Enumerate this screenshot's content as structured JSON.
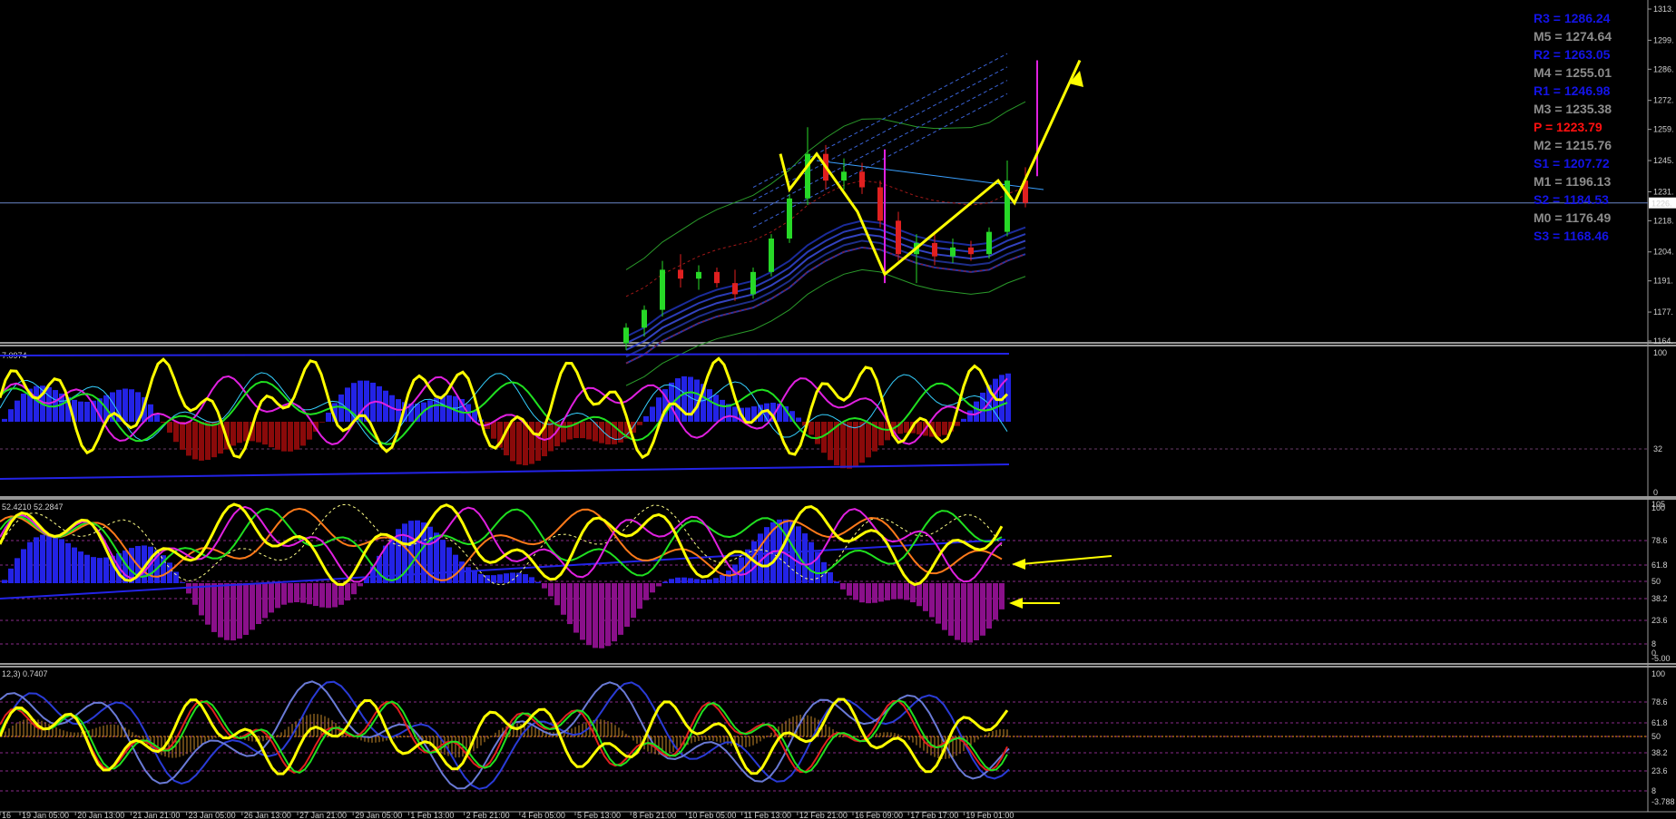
{
  "chart_data": {
    "type": "line",
    "pivot_levels": [
      {
        "label": "R3 = 1286.24",
        "color": "#1414e6"
      },
      {
        "label": "M5 = 1274.64",
        "color": "#8c8c8c"
      },
      {
        "label": "R2 = 1263.05",
        "color": "#1414e6"
      },
      {
        "label": "M4 = 1255.01",
        "color": "#8c8c8c"
      },
      {
        "label": "R1 = 1246.98",
        "color": "#1414e6"
      },
      {
        "label": "M3 = 1235.38",
        "color": "#8c8c8c"
      },
      {
        "label": "P   = 1223.79",
        "color": "#ff1010"
      },
      {
        "label": "M2 = 1215.76",
        "color": "#8c8c8c"
      },
      {
        "label": "S1 = 1207.72",
        "color": "#1414e6"
      },
      {
        "label": "M1 = 1196.13",
        "color": "#8c8c8c"
      },
      {
        "label": "S2 = 1184.53",
        "color": "#1414e6"
      },
      {
        "label": "M0 = 1176.49",
        "color": "#8c8c8c"
      },
      {
        "label": "S3 = 1168.46",
        "color": "#1414e6"
      }
    ],
    "price_axis": {
      "ticks": [
        "1313.",
        "1299.",
        "1286.",
        "1272.",
        "1259.",
        "1245.",
        "1231.",
        "1218.",
        "1204.",
        "1191.",
        "1177.",
        "1164."
      ],
      "current_price": "1226."
    },
    "panes": [
      {
        "header": "7.0974",
        "axis_ticks": [
          "100",
          "32",
          "0"
        ]
      },
      {
        "header": "52.4210 52.2847",
        "axis_ticks": [
          "105",
          "100",
          "78.6",
          "61.8",
          "50",
          "38.2",
          "23.6",
          "8",
          "0",
          "-5.00"
        ]
      },
      {
        "header": "12,3) 0.7407",
        "axis_ticks": [
          "100",
          "78.6",
          "61.8",
          "50",
          "38.2",
          "23.6",
          "8",
          "-3.788"
        ]
      }
    ],
    "time_labels": [
      "16",
      "19 Jan 05:00",
      "20 Jan 13:00",
      "21 Jan 21:00",
      "23 Jan 05:00",
      "26 Jan 13:00",
      "27 Jan 21:00",
      "29 Jan 05:00",
      "1 Feb 13:00",
      "2 Feb 21:00",
      "4 Feb 05:00",
      "5 Feb 13:00",
      "8 Feb 21:00",
      "10 Feb 05:00",
      "11 Feb 13:00",
      "12 Feb 21:00",
      "16 Feb 09:00",
      "17 Feb 17:00",
      "19 Feb 01:00"
    ],
    "candles": [
      {
        "t": 0,
        "o": 1163,
        "h": 1172,
        "l": 1160,
        "c": 1170
      },
      {
        "t": 1,
        "o": 1170,
        "h": 1180,
        "l": 1166,
        "c": 1178
      },
      {
        "t": 2,
        "o": 1178,
        "h": 1200,
        "l": 1175,
        "c": 1196
      },
      {
        "t": 3,
        "o": 1196,
        "h": 1203,
        "l": 1188,
        "c": 1192
      },
      {
        "t": 4,
        "o": 1192,
        "h": 1198,
        "l": 1187,
        "c": 1195
      },
      {
        "t": 5,
        "o": 1195,
        "h": 1197,
        "l": 1188,
        "c": 1190
      },
      {
        "t": 6,
        "o": 1190,
        "h": 1196,
        "l": 1182,
        "c": 1185
      },
      {
        "t": 7,
        "o": 1185,
        "h": 1197,
        "l": 1183,
        "c": 1195
      },
      {
        "t": 8,
        "o": 1195,
        "h": 1212,
        "l": 1193,
        "c": 1210
      },
      {
        "t": 9,
        "o": 1210,
        "h": 1230,
        "l": 1208,
        "c": 1228
      },
      {
        "t": 10,
        "o": 1228,
        "h": 1260,
        "l": 1225,
        "c": 1248
      },
      {
        "t": 11,
        "o": 1248,
        "h": 1252,
        "l": 1232,
        "c": 1236
      },
      {
        "t": 12,
        "o": 1236,
        "h": 1246,
        "l": 1232,
        "c": 1240
      },
      {
        "t": 13,
        "o": 1240,
        "h": 1244,
        "l": 1230,
        "c": 1233
      },
      {
        "t": 14,
        "o": 1233,
        "h": 1236,
        "l": 1215,
        "c": 1218
      },
      {
        "t": 15,
        "o": 1218,
        "h": 1222,
        "l": 1200,
        "c": 1203
      },
      {
        "t": 16,
        "o": 1203,
        "h": 1212,
        "l": 1190,
        "c": 1208
      },
      {
        "t": 17,
        "o": 1208,
        "h": 1213,
        "l": 1198,
        "c": 1202
      },
      {
        "t": 18,
        "o": 1202,
        "h": 1210,
        "l": 1199,
        "c": 1206
      },
      {
        "t": 19,
        "o": 1206,
        "h": 1209,
        "l": 1200,
        "c": 1203
      },
      {
        "t": 20,
        "o": 1203,
        "h": 1215,
        "l": 1201,
        "c": 1213
      },
      {
        "t": 21,
        "o": 1213,
        "h": 1245,
        "l": 1211,
        "c": 1236
      },
      {
        "t": 22,
        "o": 1236,
        "h": 1242,
        "l": 1224,
        "c": 1226
      }
    ]
  }
}
